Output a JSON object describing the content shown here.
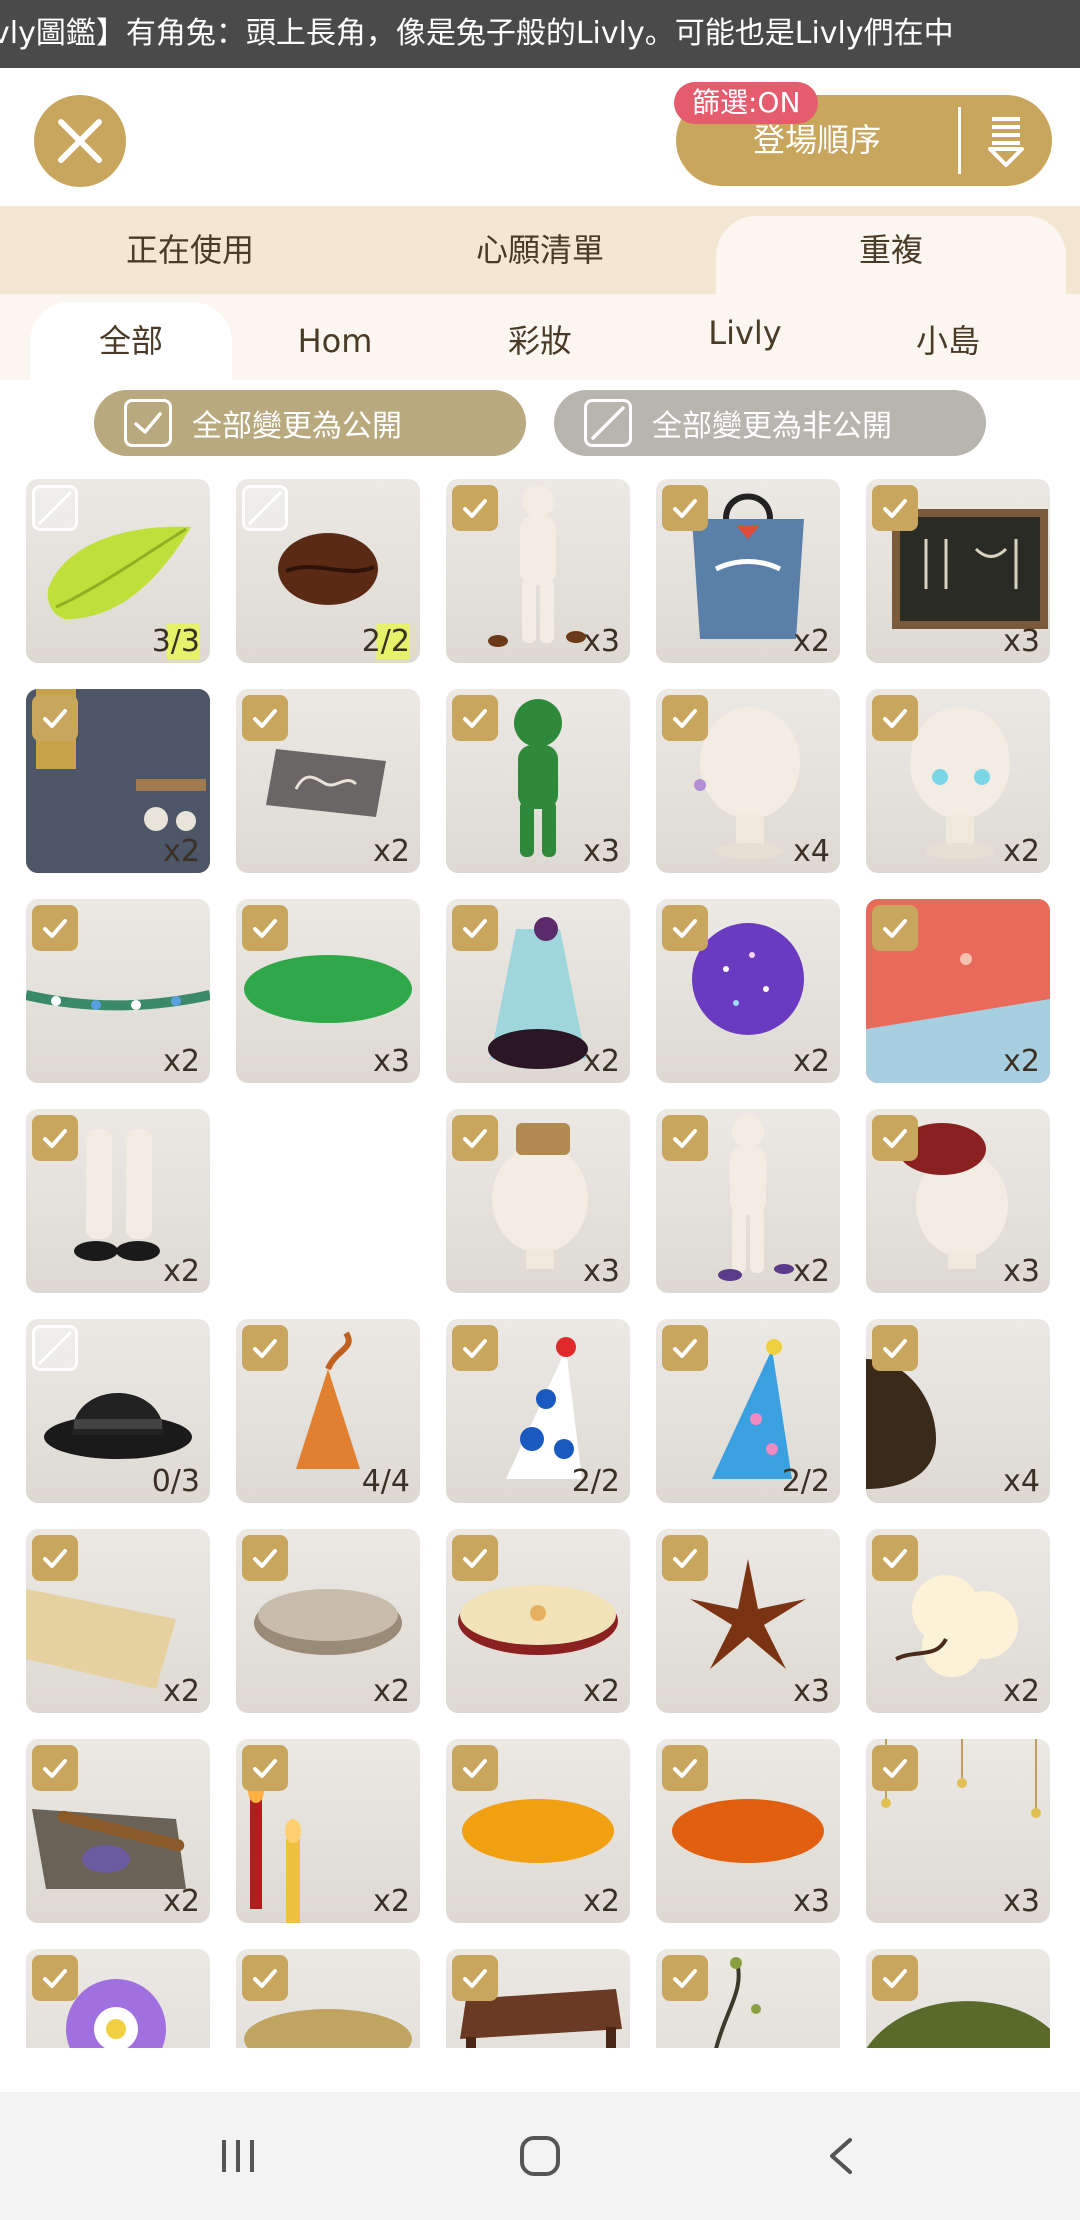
{
  "ticker": {
    "text": "vly圖鑑】有角兔：頭上長角，像是兔子般的Livly。可能也是Livly們在中"
  },
  "header": {
    "filter_badge": "篩選:ON",
    "sort_label": "登場順序"
  },
  "tabs_main": [
    {
      "label": "正在使用",
      "active": false
    },
    {
      "label": "心願清單",
      "active": false
    },
    {
      "label": "重複",
      "active": true
    }
  ],
  "tabs_category": [
    {
      "label": "全部",
      "active": true
    },
    {
      "label": "Hom",
      "active": false
    },
    {
      "label": "彩妝",
      "active": false
    },
    {
      "label": "Livly",
      "active": false
    },
    {
      "label": "小島",
      "active": false
    }
  ],
  "bulk": {
    "public_label": "全部變更為公開",
    "private_label": "全部變更為非公開"
  },
  "items": [
    {
      "name": "leaf",
      "checked": false,
      "qty": "3/3",
      "highlight": true
    },
    {
      "name": "coffee-bean",
      "checked": false,
      "qty": "2/2",
      "highlight": true
    },
    {
      "name": "body-coffee-beans",
      "checked": true,
      "qty": "x3"
    },
    {
      "name": "shopping-bag",
      "checked": true,
      "qty": "x2"
    },
    {
      "name": "chalkboard",
      "checked": true,
      "qty": "x3"
    },
    {
      "name": "cafe-wall",
      "checked": true,
      "qty": "x2"
    },
    {
      "name": "coffee-sign",
      "checked": true,
      "qty": "x2"
    },
    {
      "name": "leaf-costume",
      "checked": true,
      "qty": "x3"
    },
    {
      "name": "head-earring",
      "checked": true,
      "qty": "x4"
    },
    {
      "name": "head-blue-eyes",
      "checked": true,
      "qty": "x2"
    },
    {
      "name": "flower-garland",
      "checked": true,
      "qty": "x2"
    },
    {
      "name": "green-rug",
      "checked": true,
      "qty": "x3"
    },
    {
      "name": "floral-dress",
      "checked": true,
      "qty": "x2"
    },
    {
      "name": "galaxy-cloud",
      "checked": true,
      "qty": "x2"
    },
    {
      "name": "patchwork-blanket",
      "checked": true,
      "qty": "x2"
    },
    {
      "name": "legs-shoes",
      "checked": true,
      "qty": "x2"
    },
    {
      "name": "blank",
      "checked": null,
      "qty": ""
    },
    {
      "name": "head-bucket",
      "checked": true,
      "qty": "x3"
    },
    {
      "name": "body-purple-splash",
      "checked": true,
      "qty": "x2"
    },
    {
      "name": "head-beret",
      "checked": true,
      "qty": "x3"
    },
    {
      "name": "bowler-hat",
      "checked": false,
      "qty": "0/3"
    },
    {
      "name": "orange-hat",
      "checked": true,
      "qty": "4/4"
    },
    {
      "name": "polka-party-hat",
      "checked": true,
      "qty": "2/2"
    },
    {
      "name": "star-party-hat",
      "checked": true,
      "qty": "2/2"
    },
    {
      "name": "dark-vase",
      "checked": true,
      "qty": "x4"
    },
    {
      "name": "tea-party-card",
      "checked": true,
      "qty": "x2"
    },
    {
      "name": "round-tray",
      "checked": true,
      "qty": "x2"
    },
    {
      "name": "cake-plate",
      "checked": true,
      "qty": "x2"
    },
    {
      "name": "star-anise",
      "checked": true,
      "qty": "x3"
    },
    {
      "name": "cotton-plant",
      "checked": true,
      "qty": "x2"
    },
    {
      "name": "cinnamon-tray",
      "checked": true,
      "qty": "x2"
    },
    {
      "name": "candles",
      "checked": true,
      "qty": "x2"
    },
    {
      "name": "yellow-plate",
      "checked": true,
      "qty": "x2"
    },
    {
      "name": "orange-plate",
      "checked": true,
      "qty": "x3"
    },
    {
      "name": "hanging-stars",
      "checked": true,
      "qty": "x3"
    },
    {
      "name": "purple-flower",
      "checked": true,
      "qty": ""
    },
    {
      "name": "straw-nest",
      "checked": true,
      "qty": ""
    },
    {
      "name": "wood-table",
      "checked": true,
      "qty": ""
    },
    {
      "name": "sprout",
      "checked": true,
      "qty": ""
    },
    {
      "name": "moss-hill",
      "checked": true,
      "qty": ""
    }
  ],
  "icons": {
    "close": "close-icon",
    "sort": "sort-list-icon",
    "nav_recent": "recent-apps-icon",
    "nav_home": "home-icon",
    "nav_back": "back-icon"
  },
  "colors": {
    "accent": "#c9a65e",
    "filter_badge": "#e45c6d",
    "tab_bar": "#f3e6d3",
    "ticker_bg": "#4a4a4a"
  }
}
